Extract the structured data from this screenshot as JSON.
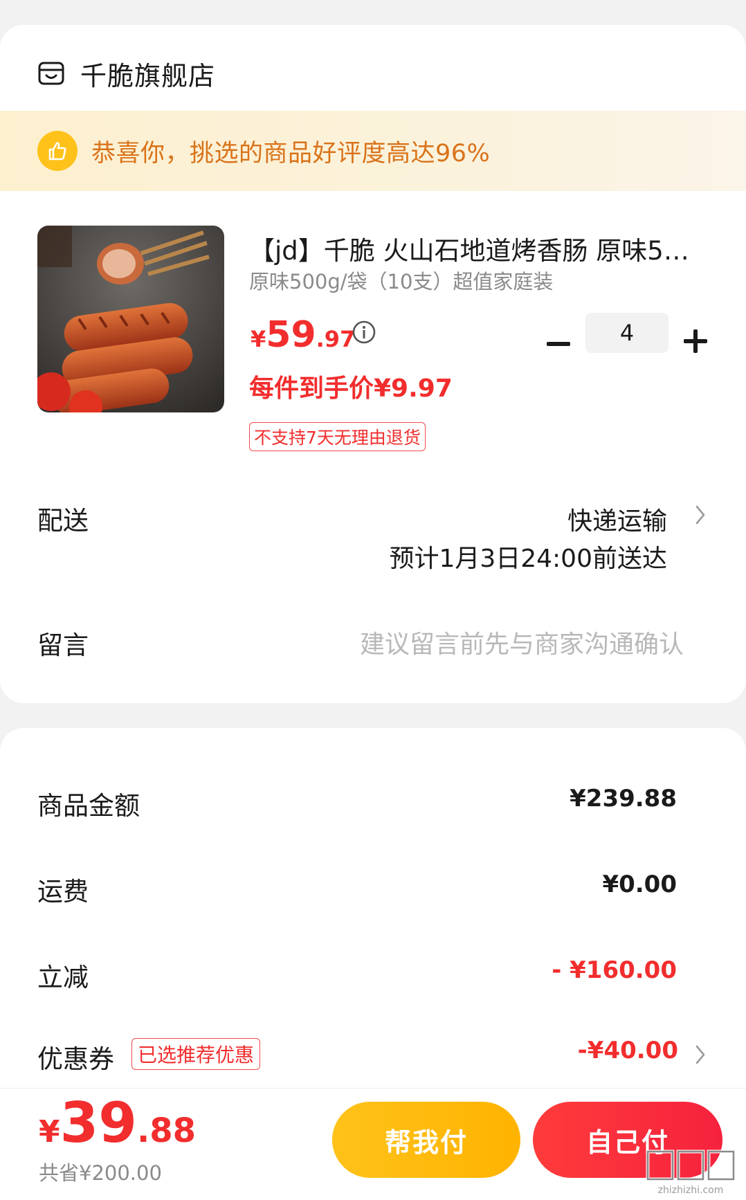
{
  "store": {
    "name": "千脆旗舰店",
    "icon": "storefront-icon"
  },
  "banner": {
    "text": "恭喜你，挑选的商品好评度高达96%",
    "icon": "thumbs-up-icon"
  },
  "product": {
    "title": "【jd】千脆 火山石地道烤香肠 原味5…",
    "spec": "原味500g/袋（10支）超值家庭装",
    "price_symbol": "¥",
    "price_int": "59",
    "price_dec": ".97",
    "per_item_price": "每件到手价¥9.97",
    "return_policy": "不支持7天无理由退货",
    "quantity": "4",
    "image": "sausage-product-image"
  },
  "delivery": {
    "label": "配送",
    "method": "快递运输",
    "eta": "预计1月3日24:00前送达"
  },
  "note": {
    "label": "留言",
    "placeholder": "建议留言前先与商家沟通确认"
  },
  "summary": {
    "goods_label": "商品金额",
    "goods_value": "¥239.88",
    "shipping_label": "运费",
    "shipping_value": "¥0.00",
    "discount_label": "立减",
    "discount_value": "- ¥160.00",
    "coupon_label": "优惠券",
    "coupon_tag": "已选推荐优惠",
    "coupon_value": "-¥40.00"
  },
  "footer": {
    "total_symbol": "¥",
    "total_int": "39",
    "total_dec": ".88",
    "saved": "共省¥200.00",
    "help_pay": "帮我付",
    "self_pay": "自己付"
  },
  "colors": {
    "accent_red": "#f22d2d",
    "accent_yellow": "#ffc21a",
    "banner_text": "#d9731a"
  }
}
